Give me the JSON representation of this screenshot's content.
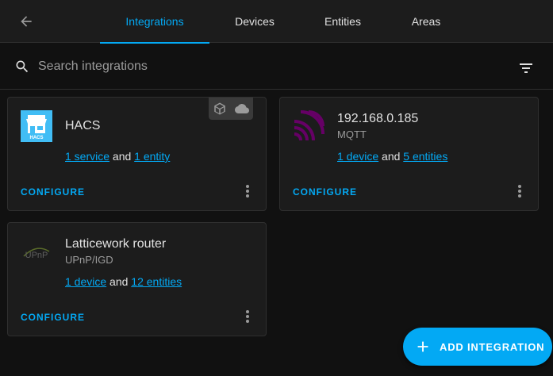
{
  "header": {
    "tabs": [
      {
        "label": "Integrations",
        "active": true
      },
      {
        "label": "Devices",
        "active": false
      },
      {
        "label": "Entities",
        "active": false
      },
      {
        "label": "Areas",
        "active": false
      }
    ]
  },
  "search": {
    "placeholder": "Search integrations",
    "value": ""
  },
  "cards": [
    {
      "title": "HACS",
      "subtitle": "",
      "logo": "hacs-store-logo",
      "link1_text": "1 service",
      "joiner": " and ",
      "link2_text": "1 entity",
      "configure_label": "CONFIGURE",
      "badges": [
        "package-icon",
        "cloud-icon"
      ]
    },
    {
      "title": "192.168.0.185",
      "subtitle": "MQTT",
      "logo": "mqtt-logo",
      "link1_text": "1 device",
      "joiner": " and ",
      "link2_text": "5 entities",
      "configure_label": "CONFIGURE"
    },
    {
      "title": "Latticework router",
      "subtitle": "UPnP/IGD",
      "logo": "upnp-logo",
      "logo_text": "UPnP",
      "link1_text": "1 device",
      "joiner": " and ",
      "link2_text": "12 entities",
      "configure_label": "CONFIGURE"
    }
  ],
  "fab": {
    "label": "ADD INTEGRATION"
  },
  "colors": {
    "accent": "#03a9f4",
    "card_background": "#1c1c1c",
    "page_background": "#111111",
    "hacs_blue": "#41bdf5",
    "mqtt_purple": "#660066"
  }
}
